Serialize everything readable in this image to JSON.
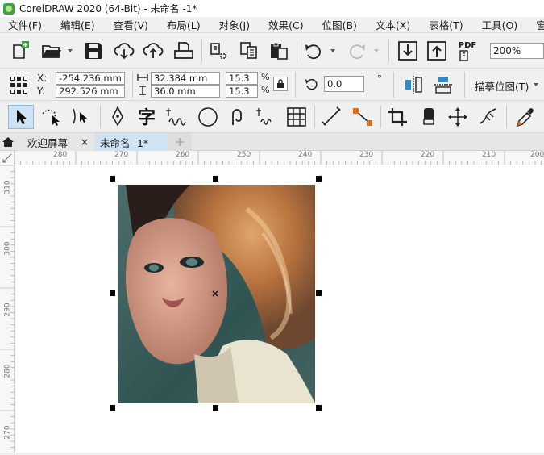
{
  "window": {
    "title": "CorelDRAW 2020 (64-Bit) - 未命名 -1*"
  },
  "menu": [
    "文件(F)",
    "编辑(E)",
    "查看(V)",
    "布局(L)",
    "对象(J)",
    "效果(C)",
    "位图(B)",
    "文本(X)",
    "表格(T)",
    "工具(O)",
    "窗口"
  ],
  "toolbar": {
    "zoom_value": "200%",
    "pdf_label": "PDF"
  },
  "property_bar": {
    "x_label": "X:",
    "y_label": "Y:",
    "x_value": "-254.236 mm",
    "y_value": "292.526 mm",
    "width_value": "32.384 mm",
    "height_value": "36.0 mm",
    "scale_w": "15.3",
    "scale_h": "15.3",
    "percent": "%",
    "rotation_value": "0.0",
    "degree": "°",
    "trace_bitmap_label": "描摹位图(T)"
  },
  "tabs": [
    {
      "label": "欢迎屏幕",
      "close": "×"
    },
    {
      "label": "未命名 -1*"
    }
  ],
  "rulers": {
    "horizontal": [
      "280",
      "270",
      "260",
      "250",
      "240",
      "230",
      "220",
      "210",
      "200"
    ],
    "vertical": [
      "310",
      "300",
      "290",
      "280",
      "270"
    ]
  },
  "icons": {
    "new": "new-document-icon",
    "open": "open-folder-icon",
    "save": "save-icon",
    "cloud_down": "cloud-download-icon",
    "cloud_up": "cloud-upload-icon",
    "print": "print-icon",
    "cut": "cut-icon",
    "copy": "copy-icon",
    "paste": "paste-icon",
    "undo": "undo-icon",
    "redo": "redo-icon",
    "import": "import-icon",
    "export": "export-icon",
    "publish_pdf": "publish-pdf-icon",
    "lock": "lock-ratio-icon",
    "pick": "pick-tool-icon",
    "freehand": "freehand-pick-icon",
    "shape": "shape-tool-icon",
    "pen": "pen-tool-icon",
    "text": "text-tool-icon",
    "artistic": "artistic-media-icon",
    "ellipse": "ellipse-tool-icon",
    "spiral": "spiral-tool-icon",
    "table": "table-tool-icon",
    "dimension": "dimension-tool-icon",
    "connector": "connector-tool-icon",
    "crop": "crop-tool-icon",
    "eraser": "eraser-tool-icon",
    "transform": "transform-tool-icon",
    "eyedropper": "eyedropper-tool-icon",
    "home": "home-icon",
    "add_tab": "add-tab-icon"
  },
  "colors": {
    "accent_tab": "#cfe3f5",
    "handle": "#000000",
    "logo": "#3aa345"
  }
}
